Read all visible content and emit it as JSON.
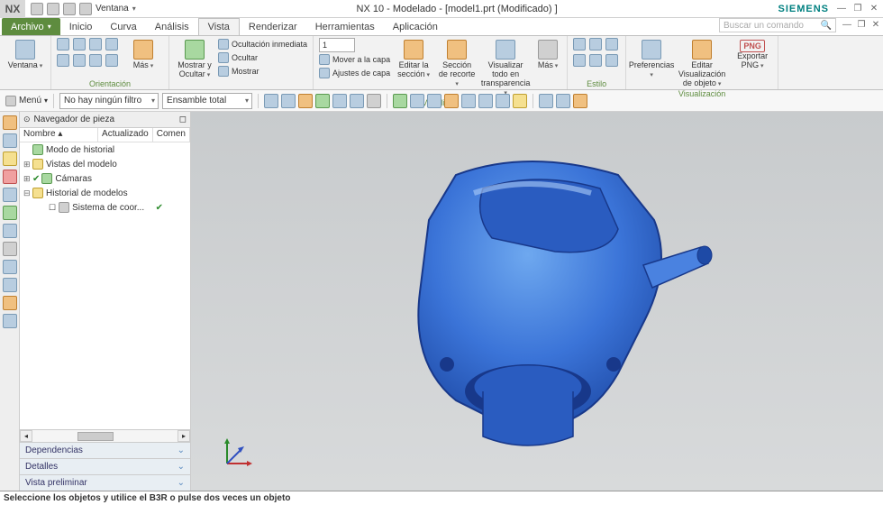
{
  "title": "NX 10 - Modelado - [model1.prt (Modificado) ]",
  "brand": "SIEMENS",
  "nx_logo": "NX",
  "qat_label": "Ventana",
  "search_placeholder": "Buscar un comando",
  "file_menu": "Archivo",
  "tabs": [
    "Inicio",
    "Curva",
    "Análisis",
    "Vista",
    "Renderizar",
    "Herramientas",
    "Aplicación"
  ],
  "active_tab": "Vista",
  "ribbon": {
    "g1": {
      "btn": "Ventana",
      "label": ""
    },
    "g2": {
      "btn": "Más",
      "label": "Orientación"
    },
    "g3": {
      "btn": "Mostrar y Ocultar",
      "items": [
        "Ocultación inmediata",
        "Ocultar",
        "Mostrar"
      ]
    },
    "g4": {
      "num": "1",
      "items": [
        "Mover a la capa",
        "Ajustes de capa"
      ],
      "btn1": "Editar la sección",
      "btn2": "Sección de recorte",
      "btn3": "Visualizar todo en transparencia",
      "btn4": "Más",
      "label": "Visibilidad"
    },
    "g5": {
      "label": "Estilo"
    },
    "g6": {
      "btn1": "Preferencias",
      "btn2": "Editar Visualización de objeto",
      "btn3": "Exportar PNG",
      "badge": "PNG",
      "label": "Visualización"
    }
  },
  "toolbar": {
    "menu": "Menú",
    "filter": "No hay ningún filtro",
    "assembly": "Ensamble total"
  },
  "panel": {
    "title": "Navegador de pieza",
    "cols": [
      "Nombre",
      "Actualizado",
      "Comen"
    ],
    "rows": [
      {
        "label": "Modo de historial",
        "icon": "green"
      },
      {
        "label": "Vistas del modelo",
        "icon": "yellow",
        "expandable": true
      },
      {
        "label": "Cámaras",
        "icon": "green",
        "expandable": true,
        "check": true
      },
      {
        "label": "Historial de modelos",
        "icon": "yellow",
        "expandable": true,
        "open": true
      },
      {
        "label": "Sistema de coor...",
        "icon": "grey",
        "child": true,
        "check": true,
        "checkbox": true
      }
    ],
    "sections": [
      "Dependencias",
      "Detalles",
      "Vista preliminar"
    ]
  },
  "status": "Seleccione los objetos y utilice el B3R o pulse dos veces un objeto"
}
